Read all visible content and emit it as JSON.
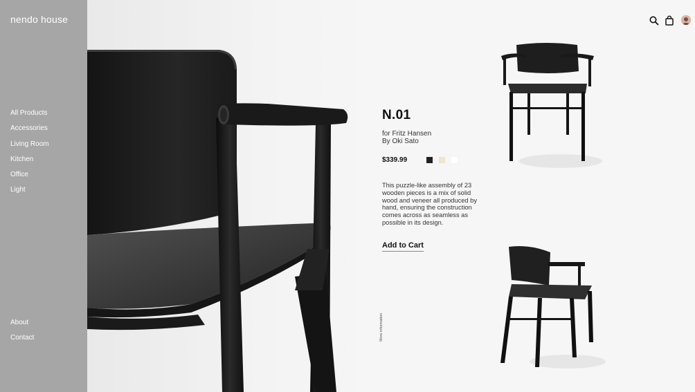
{
  "sidebar": {
    "brand": "nendo house",
    "nav_items": [
      "All Products",
      "Accessories",
      "Living Room",
      "Kitchen",
      "Office",
      "Light"
    ],
    "footer_items": [
      "About",
      "Contact"
    ]
  },
  "header": {
    "icons": [
      "search-icon",
      "shopping-bag-icon",
      "user-avatar"
    ]
  },
  "product": {
    "name": "N.01",
    "for_line": "for Fritz Hansen",
    "by_line": "By Oki Sato",
    "price": "$339.99",
    "swatches": [
      "#222222",
      "#efe5cf",
      "#ffffff"
    ],
    "description": "This puzzle-like assembly of 23 wooden pieces is a mix of solid wood and veneer all produced by hand, ensuring the construction comes across as seamless as possible in its design.",
    "cta": "Add to Cart",
    "more_info": "More information"
  },
  "colors": {
    "sidebar_bg": "#a6a6a6",
    "chair": "#1c1c1c",
    "cta_underline": "#7b8aa8"
  }
}
